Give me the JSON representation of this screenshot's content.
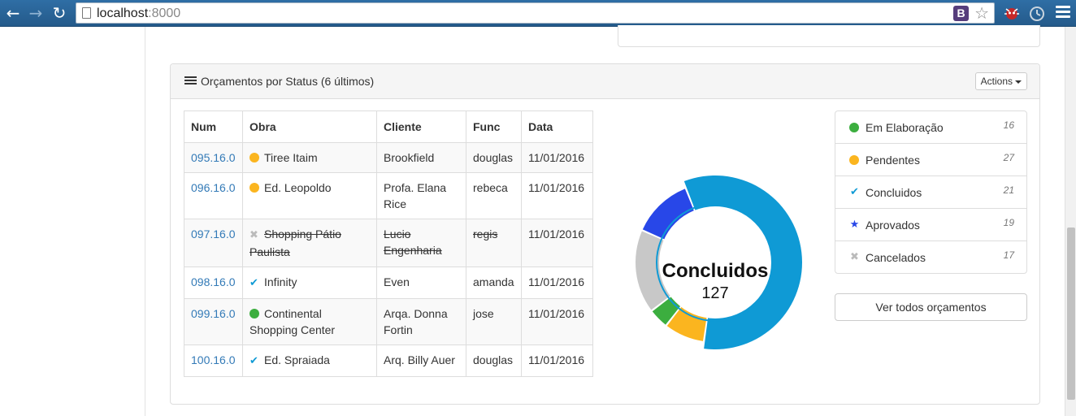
{
  "browser": {
    "url_host": "localhost",
    "url_port": ":8000",
    "bootstrap_ext_label": "B"
  },
  "panel": {
    "title": "Orçamentos por Status (6 últimos)",
    "actions_label": "Actions"
  },
  "table": {
    "headers": [
      "Num",
      "Obra",
      "Cliente",
      "Func",
      "Data"
    ],
    "rows": [
      {
        "num": "095.16.0",
        "obra": "Tiree Itaim",
        "cliente": "Brookfield",
        "func": "douglas",
        "data": "11/01/2016",
        "status": "pendente",
        "cancelled": false
      },
      {
        "num": "096.16.0",
        "obra": "Ed. Leopoldo",
        "cliente": "Profa. Elana Rice",
        "func": "rebeca",
        "data": "11/01/2016",
        "status": "pendente",
        "cancelled": false
      },
      {
        "num": "097.16.0",
        "obra": "Shopping Pátio Paulista",
        "cliente": "Lucio Engenharia",
        "func": "regis",
        "data": "11/01/2016",
        "status": "cancelado",
        "cancelled": true
      },
      {
        "num": "098.16.0",
        "obra": "Infinity",
        "cliente": "Even",
        "func": "amanda",
        "data": "11/01/2016",
        "status": "concluido",
        "cancelled": false
      },
      {
        "num": "099.16.0",
        "obra": "Continental Shopping Center",
        "cliente": "Arqa. Donna Fortin",
        "func": "jose",
        "data": "11/01/2016",
        "status": "elaboracao",
        "cancelled": false
      },
      {
        "num": "100.16.0",
        "obra": "Ed. Spraiada",
        "cliente": "Arq. Billy Auer",
        "func": "douglas",
        "data": "11/01/2016",
        "status": "concluido",
        "cancelled": false
      }
    ]
  },
  "donut": {
    "title": "Concluidos",
    "value": "127"
  },
  "status_list": [
    {
      "key": "elaboracao",
      "label": "Em Elaboração",
      "count": "16",
      "icon": "green-dot-icon",
      "color": "#3cae3f"
    },
    {
      "key": "pendente",
      "label": "Pendentes",
      "count": "27",
      "icon": "yellow-dot-icon",
      "color": "#fbb51f"
    },
    {
      "key": "concluido",
      "label": "Concluidos",
      "count": "21",
      "icon": "check-icon",
      "color": "#0f9ad5"
    },
    {
      "key": "aprovado",
      "label": "Aprovados",
      "count": "19",
      "icon": "star-icon",
      "color": "#2847e8"
    },
    {
      "key": "cancelado",
      "label": "Cancelados",
      "count": "17",
      "icon": "cross-icon",
      "color": "#bbbbbb"
    }
  ],
  "ver_todos_label": "Ver todos orçamentos",
  "chart_data": {
    "type": "pie",
    "categories": [
      "Concluidos",
      "Pendentes",
      "Em Elaboração",
      "Cancelados",
      "Aprovados"
    ],
    "values": [
      127,
      18,
      9,
      37,
      27
    ],
    "colors": [
      "#0f9ad5",
      "#fbb51f",
      "#3cae3f",
      "#c8c8c8",
      "#2847e8"
    ],
    "title": "Concluidos",
    "highlighted": "Concluidos"
  }
}
